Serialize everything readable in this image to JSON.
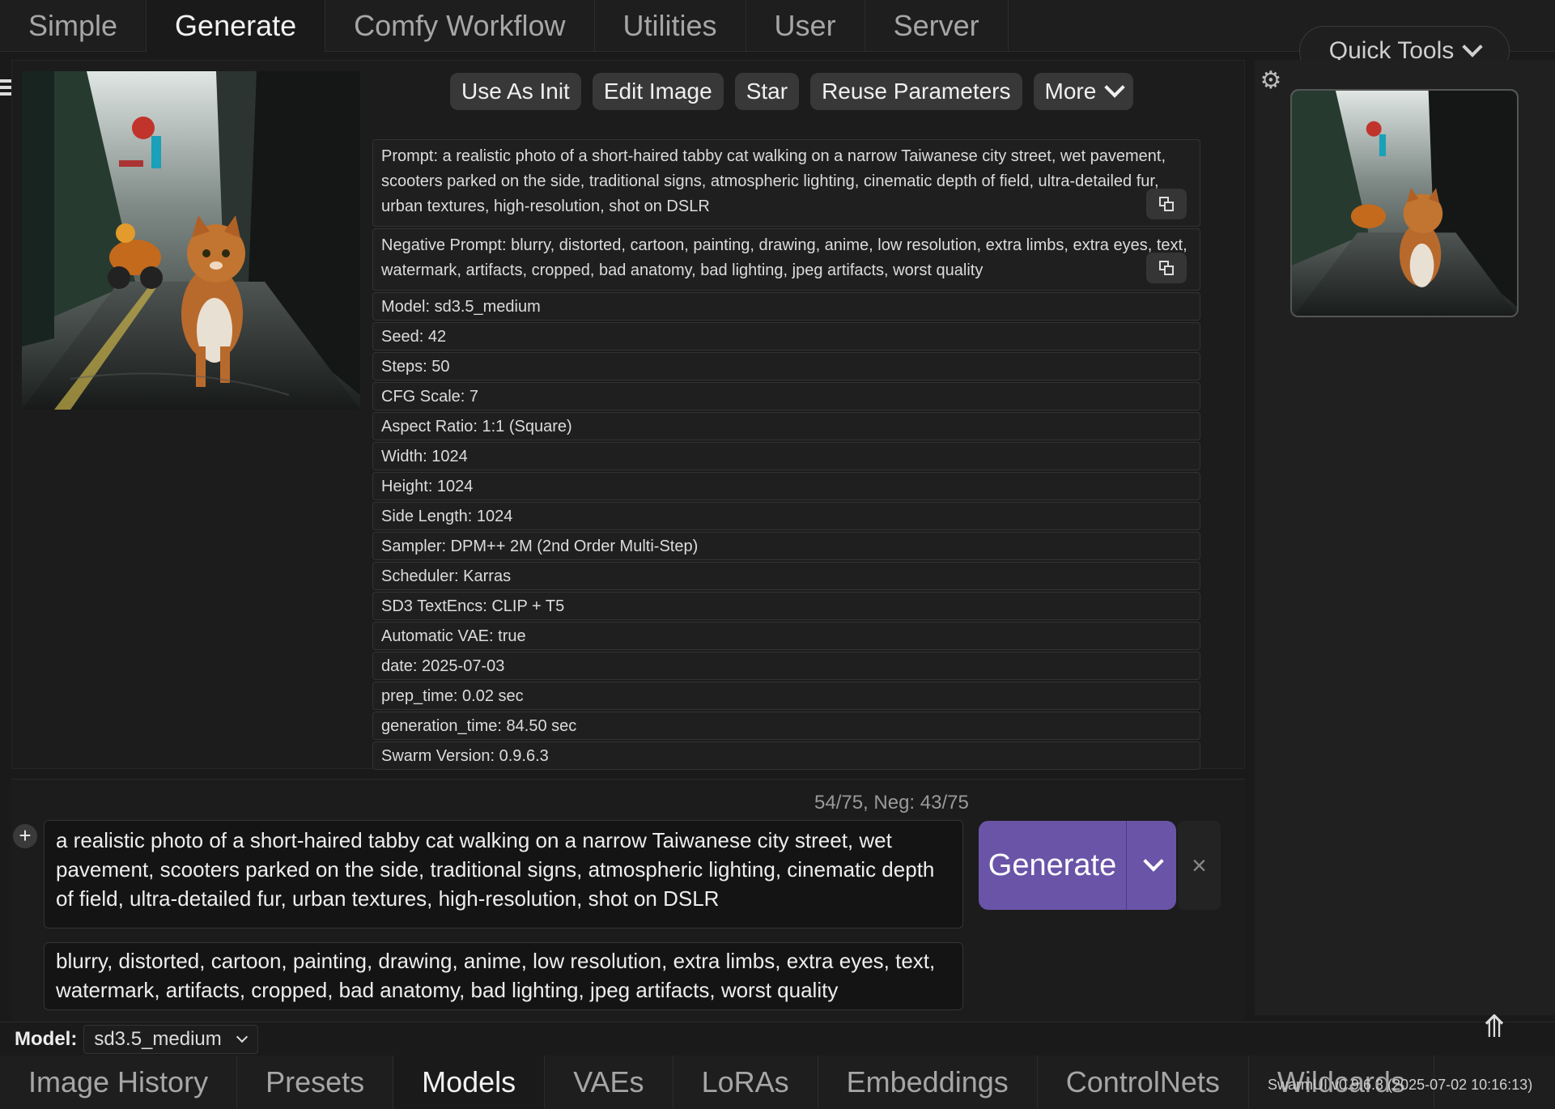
{
  "top_tabs": [
    "Simple",
    "Generate",
    "Comfy Workflow",
    "Utilities",
    "User",
    "Server"
  ],
  "active_top_tab": "Generate",
  "quick_tools": "Quick Tools",
  "actions": {
    "use_as_init": "Use As Init",
    "edit_image": "Edit Image",
    "star": "Star",
    "reuse_parameters": "Reuse Parameters",
    "more": "More"
  },
  "metadata": {
    "prompt": "Prompt: a realistic photo of a short-haired tabby cat walking on a narrow Taiwanese city street, wet pavement, scooters parked on the side, traditional signs, atmospheric lighting, cinematic depth of field, ultra-detailed fur, urban textures, high-resolution, shot on DSLR",
    "negative_prompt": "Negative Prompt: blurry, distorted, cartoon, painting, drawing, anime, low resolution, extra limbs, extra eyes, text, watermark, artifacts, cropped, bad anatomy, bad lighting, jpeg artifacts, worst quality",
    "rows": [
      "Model: sd3.5_medium",
      "Seed: 42",
      "Steps: 50",
      "CFG Scale: 7",
      "Aspect Ratio: 1:1 (Square)",
      "Width: 1024",
      "Height: 1024",
      "Side Length: 1024",
      "Sampler: DPM++ 2M (2nd Order Multi-Step)",
      "Scheduler: Karras",
      "SD3 TextEncs: CLIP + T5",
      "Automatic VAE: true",
      "date: 2025-07-03",
      "prep_time: 0.02 sec",
      "generation_time: 84.50 sec",
      "Swarm Version: 0.9.6.3"
    ]
  },
  "token_count": "54/75, Neg: 43/75",
  "prompt_text": "a realistic photo of a short-haired tabby cat walking on a narrow Taiwanese city street, wet pavement, scooters parked on the side, traditional signs, atmospheric lighting, cinematic depth of field, ultra-detailed fur, urban textures, high-resolution, shot on DSLR",
  "negative_prompt_text": "blurry, distorted, cartoon, painting, drawing, anime, low resolution, extra limbs, extra eyes, text, watermark, artifacts, cropped, bad anatomy, bad lighting, jpeg artifacts, worst quality",
  "generate_label": "Generate",
  "cancel_label": "×",
  "plus_label": "+",
  "model_label": "Model:",
  "model_value": "sd3.5_medium",
  "bottom_tabs": [
    "Image History",
    "Presets",
    "Models",
    "VAEs",
    "LoRAs",
    "Embeddings",
    "ControlNets",
    "Wildcards"
  ],
  "active_bottom_tab": "Models",
  "version": "SwarmUI v0.9.6.3 (2025-07-02 10:16:13)",
  "colors": {
    "accent": "#6a54a8",
    "background": "#1a1a1a"
  }
}
